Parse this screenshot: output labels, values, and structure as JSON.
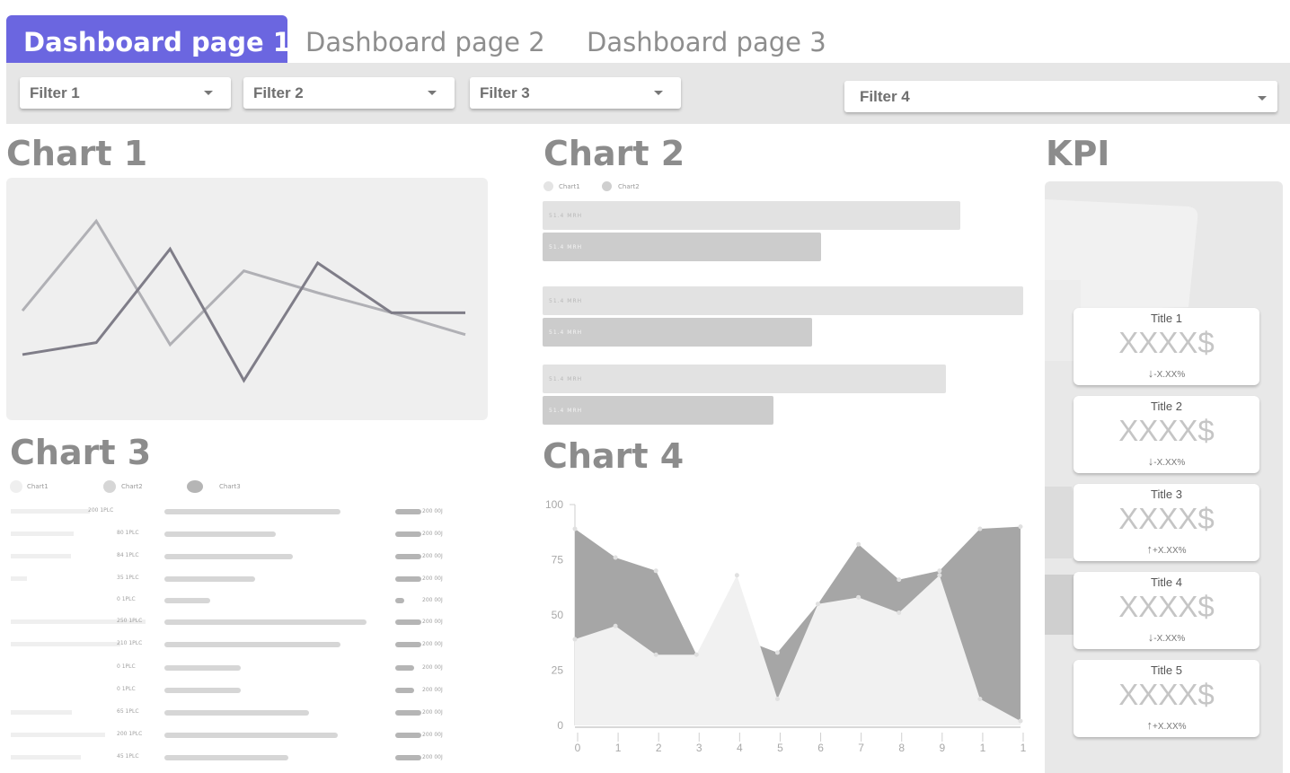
{
  "tabs": [
    {
      "label": "Dashboard page 1",
      "active": true
    },
    {
      "label": "Dashboard page 2",
      "active": false
    },
    {
      "label": "Dashboard page 3",
      "active": false
    }
  ],
  "filters": [
    "Filter 1",
    "Filter 2",
    "Filter 3",
    "Filter 4"
  ],
  "charts": {
    "chart1": {
      "title": "Chart 1"
    },
    "chart2": {
      "title": "Chart 2",
      "legend": [
        "Chart1",
        "Chart2"
      ],
      "bar_label": "51.4 MRH"
    },
    "chart3": {
      "title": "Chart 3",
      "legend": [
        "Chart1",
        "Chart2",
        "Chart3"
      ]
    },
    "chart4": {
      "title": "Chart 4"
    }
  },
  "kpi": {
    "title": "KPI",
    "cards": [
      {
        "title": "Title 1",
        "value": "XXXX$",
        "delta": "-X.XX%",
        "direction": "down"
      },
      {
        "title": "Title 2",
        "value": "XXXX$",
        "delta": "-X.XX%",
        "direction": "down"
      },
      {
        "title": "Title 3",
        "value": "XXXX$",
        "delta": "+X.XX%",
        "direction": "up"
      },
      {
        "title": "Title 4",
        "value": "XXXX$",
        "delta": "-X.XX%",
        "direction": "down"
      },
      {
        "title": "Title 5",
        "value": "XXXX$",
        "delta": "+X.XX%",
        "direction": "up"
      }
    ]
  },
  "chart_data": [
    {
      "type": "line",
      "title": "Chart 1",
      "x": [
        0,
        1,
        2,
        3,
        4,
        5,
        6
      ],
      "series": [
        {
          "values": [
            45,
            90,
            28,
            65,
            54,
            44,
            33
          ],
          "color": "#b0b0b5"
        },
        {
          "values": [
            23,
            29,
            76,
            10,
            69,
            44,
            44
          ],
          "color": "#7f7d88"
        }
      ]
    },
    {
      "type": "bar",
      "title": "Chart 2",
      "orientation": "horizontal",
      "legend": [
        "Chart1",
        "Chart2"
      ],
      "categories": [
        "",
        "",
        ""
      ],
      "series": [
        {
          "name": "Chart1",
          "values": [
            87,
            100,
            84
          ],
          "color": "#e2e2e2"
        },
        {
          "name": "Chart2",
          "values": [
            58,
            56,
            48
          ],
          "color": "#cccccc"
        }
      ],
      "xlim": [
        0,
        100
      ],
      "data_label": "51.4 MRH"
    },
    {
      "type": "bar",
      "title": "Chart 3",
      "orientation": "horizontal",
      "legend": [
        "Chart1",
        "Chart2",
        "Chart3"
      ],
      "value_labels": [
        "200 1PLC",
        "80 1PLC",
        "84 1PLC",
        "35 1PLC",
        "0 1PLC",
        "250 1PLC",
        "210 1PLC",
        "0 1PLC",
        "0 1PLC",
        "65 1PLC",
        "200 1PLC",
        "45 1PLC"
      ],
      "series": [
        {
          "name": "Chart1",
          "values": [
            88,
            70,
            67,
            18,
            0,
            150,
            122,
            0,
            0,
            68,
            105,
            78
          ],
          "color": "#efefef"
        },
        {
          "name": "Chart2",
          "values": [
            85,
            54,
            62,
            44,
            22,
            98,
            85,
            37,
            37,
            70,
            84,
            60
          ],
          "color": "#d6d6d6"
        },
        {
          "name": "Chart3",
          "values": [
            22,
            22,
            22,
            22,
            8,
            22,
            22,
            16,
            16,
            22,
            22,
            22
          ],
          "color": "#b5b5b5"
        }
      ],
      "end_label": "200 00J"
    },
    {
      "type": "area",
      "title": "Chart 4",
      "x": [
        0,
        1,
        2,
        3,
        4,
        5,
        6,
        7,
        8,
        9,
        10,
        11
      ],
      "x_tick_labels": [
        "0",
        "1",
        "2",
        "3",
        "4",
        "5",
        "6",
        "7",
        "8",
        "9",
        "1",
        "1"
      ],
      "ylim": [
        0,
        100
      ],
      "y_ticks": [
        0,
        25,
        50,
        75,
        100
      ],
      "series": [
        {
          "values": [
            89,
            76,
            70,
            32,
            40,
            33,
            55,
            82,
            66,
            70,
            89,
            90
          ],
          "color": "#a6a6a6"
        },
        {
          "values": [
            39,
            45,
            32,
            32,
            68,
            12,
            55,
            58,
            51,
            68,
            12,
            2
          ],
          "color": "#f1f1f1"
        }
      ]
    }
  ]
}
